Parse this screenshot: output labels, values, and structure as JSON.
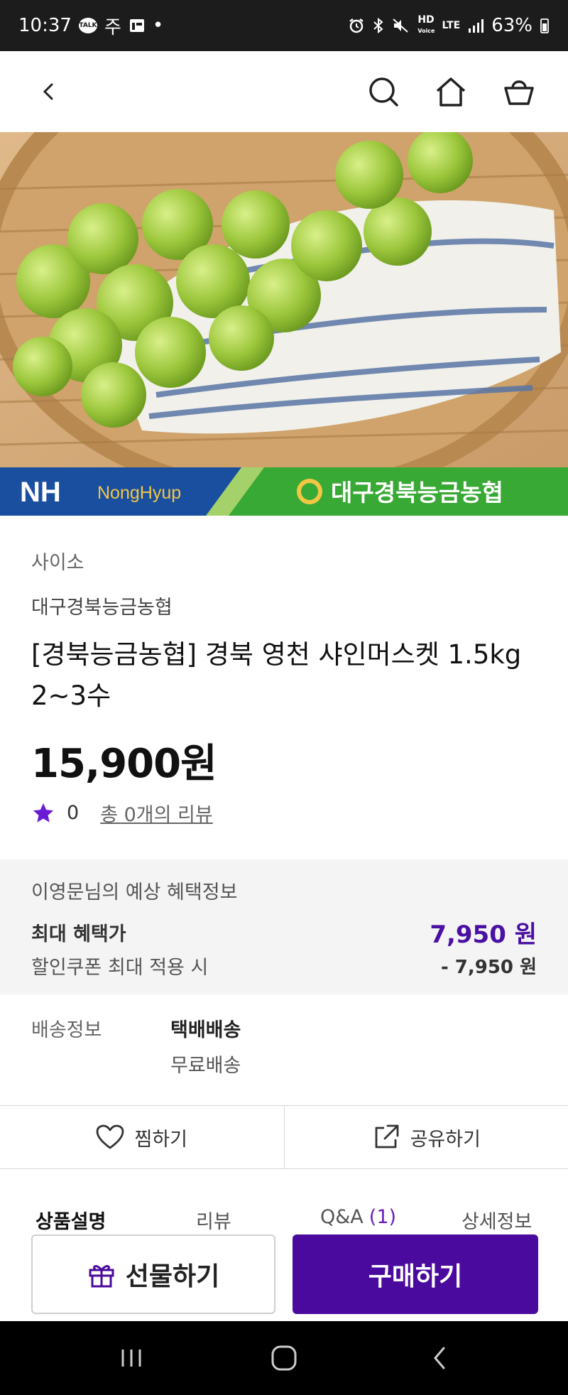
{
  "status_bar": {
    "time": "10:37",
    "talk_label": "TALK",
    "carrier_text": "주",
    "dot": "•",
    "hd_label": "HD",
    "voice_label": "Voice",
    "lte_label": "LTE",
    "battery": "63%"
  },
  "header": {
    "icons": [
      "back-icon",
      "search-icon",
      "home-icon",
      "cart-icon"
    ]
  },
  "banner": {
    "nh_text": "NH",
    "nonghyup_text": "NongHyup",
    "coop_name": "대구경북능금농협"
  },
  "product": {
    "category": "사이소",
    "seller": "대구경북능금농협",
    "title": "[경북능금농협] 경북 영천 샤인머스켓 1.5kg 2~3수",
    "price": "15,900원",
    "rating_value": "0",
    "review_link": "총 0개의 리뷰"
  },
  "benefit": {
    "title": "이영문님의 예상 혜택정보",
    "max_label": "최대 혜택가",
    "max_price": "7,950 원",
    "coupon_label": "할인쿠폰 최대 적용 시",
    "coupon_value": "- 7,950 원"
  },
  "shipping": {
    "label": "배송정보",
    "type": "택배배송",
    "fee": "무료배송"
  },
  "actions": {
    "wish_label": "찜하기",
    "share_label": "공유하기"
  },
  "tabs": {
    "description": "상품설명",
    "review": "리뷰",
    "qna": "Q&A",
    "qna_count": "(1)",
    "detail": "상세정보"
  },
  "cta": {
    "gift_label": "선물하기",
    "buy_label": "구매하기"
  },
  "colors": {
    "accent": "#4b0a9e",
    "price_accent": "#4a0fa3",
    "star": "#6a1bd4",
    "banner_blue": "#1a4fa0",
    "banner_green": "#39a935"
  }
}
